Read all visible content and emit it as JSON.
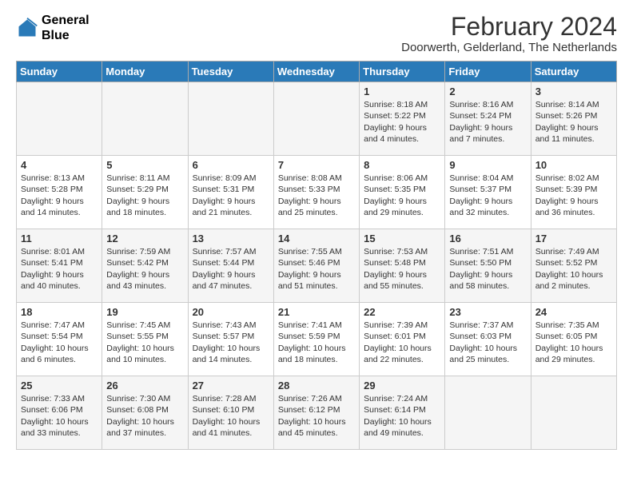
{
  "header": {
    "logo_line1": "General",
    "logo_line2": "Blue",
    "month_title": "February 2024",
    "location": "Doorwerth, Gelderland, The Netherlands"
  },
  "days_of_week": [
    "Sunday",
    "Monday",
    "Tuesday",
    "Wednesday",
    "Thursday",
    "Friday",
    "Saturday"
  ],
  "weeks": [
    [
      {
        "day": "",
        "info": ""
      },
      {
        "day": "",
        "info": ""
      },
      {
        "day": "",
        "info": ""
      },
      {
        "day": "",
        "info": ""
      },
      {
        "day": "1",
        "info": "Sunrise: 8:18 AM\nSunset: 5:22 PM\nDaylight: 9 hours\nand 4 minutes."
      },
      {
        "day": "2",
        "info": "Sunrise: 8:16 AM\nSunset: 5:24 PM\nDaylight: 9 hours\nand 7 minutes."
      },
      {
        "day": "3",
        "info": "Sunrise: 8:14 AM\nSunset: 5:26 PM\nDaylight: 9 hours\nand 11 minutes."
      }
    ],
    [
      {
        "day": "4",
        "info": "Sunrise: 8:13 AM\nSunset: 5:28 PM\nDaylight: 9 hours\nand 14 minutes."
      },
      {
        "day": "5",
        "info": "Sunrise: 8:11 AM\nSunset: 5:29 PM\nDaylight: 9 hours\nand 18 minutes."
      },
      {
        "day": "6",
        "info": "Sunrise: 8:09 AM\nSunset: 5:31 PM\nDaylight: 9 hours\nand 21 minutes."
      },
      {
        "day": "7",
        "info": "Sunrise: 8:08 AM\nSunset: 5:33 PM\nDaylight: 9 hours\nand 25 minutes."
      },
      {
        "day": "8",
        "info": "Sunrise: 8:06 AM\nSunset: 5:35 PM\nDaylight: 9 hours\nand 29 minutes."
      },
      {
        "day": "9",
        "info": "Sunrise: 8:04 AM\nSunset: 5:37 PM\nDaylight: 9 hours\nand 32 minutes."
      },
      {
        "day": "10",
        "info": "Sunrise: 8:02 AM\nSunset: 5:39 PM\nDaylight: 9 hours\nand 36 minutes."
      }
    ],
    [
      {
        "day": "11",
        "info": "Sunrise: 8:01 AM\nSunset: 5:41 PM\nDaylight: 9 hours\nand 40 minutes."
      },
      {
        "day": "12",
        "info": "Sunrise: 7:59 AM\nSunset: 5:42 PM\nDaylight: 9 hours\nand 43 minutes."
      },
      {
        "day": "13",
        "info": "Sunrise: 7:57 AM\nSunset: 5:44 PM\nDaylight: 9 hours\nand 47 minutes."
      },
      {
        "day": "14",
        "info": "Sunrise: 7:55 AM\nSunset: 5:46 PM\nDaylight: 9 hours\nand 51 minutes."
      },
      {
        "day": "15",
        "info": "Sunrise: 7:53 AM\nSunset: 5:48 PM\nDaylight: 9 hours\nand 55 minutes."
      },
      {
        "day": "16",
        "info": "Sunrise: 7:51 AM\nSunset: 5:50 PM\nDaylight: 9 hours\nand 58 minutes."
      },
      {
        "day": "17",
        "info": "Sunrise: 7:49 AM\nSunset: 5:52 PM\nDaylight: 10 hours\nand 2 minutes."
      }
    ],
    [
      {
        "day": "18",
        "info": "Sunrise: 7:47 AM\nSunset: 5:54 PM\nDaylight: 10 hours\nand 6 minutes."
      },
      {
        "day": "19",
        "info": "Sunrise: 7:45 AM\nSunset: 5:55 PM\nDaylight: 10 hours\nand 10 minutes."
      },
      {
        "day": "20",
        "info": "Sunrise: 7:43 AM\nSunset: 5:57 PM\nDaylight: 10 hours\nand 14 minutes."
      },
      {
        "day": "21",
        "info": "Sunrise: 7:41 AM\nSunset: 5:59 PM\nDaylight: 10 hours\nand 18 minutes."
      },
      {
        "day": "22",
        "info": "Sunrise: 7:39 AM\nSunset: 6:01 PM\nDaylight: 10 hours\nand 22 minutes."
      },
      {
        "day": "23",
        "info": "Sunrise: 7:37 AM\nSunset: 6:03 PM\nDaylight: 10 hours\nand 25 minutes."
      },
      {
        "day": "24",
        "info": "Sunrise: 7:35 AM\nSunset: 6:05 PM\nDaylight: 10 hours\nand 29 minutes."
      }
    ],
    [
      {
        "day": "25",
        "info": "Sunrise: 7:33 AM\nSunset: 6:06 PM\nDaylight: 10 hours\nand 33 minutes."
      },
      {
        "day": "26",
        "info": "Sunrise: 7:30 AM\nSunset: 6:08 PM\nDaylight: 10 hours\nand 37 minutes."
      },
      {
        "day": "27",
        "info": "Sunrise: 7:28 AM\nSunset: 6:10 PM\nDaylight: 10 hours\nand 41 minutes."
      },
      {
        "day": "28",
        "info": "Sunrise: 7:26 AM\nSunset: 6:12 PM\nDaylight: 10 hours\nand 45 minutes."
      },
      {
        "day": "29",
        "info": "Sunrise: 7:24 AM\nSunset: 6:14 PM\nDaylight: 10 hours\nand 49 minutes."
      },
      {
        "day": "",
        "info": ""
      },
      {
        "day": "",
        "info": ""
      }
    ]
  ]
}
